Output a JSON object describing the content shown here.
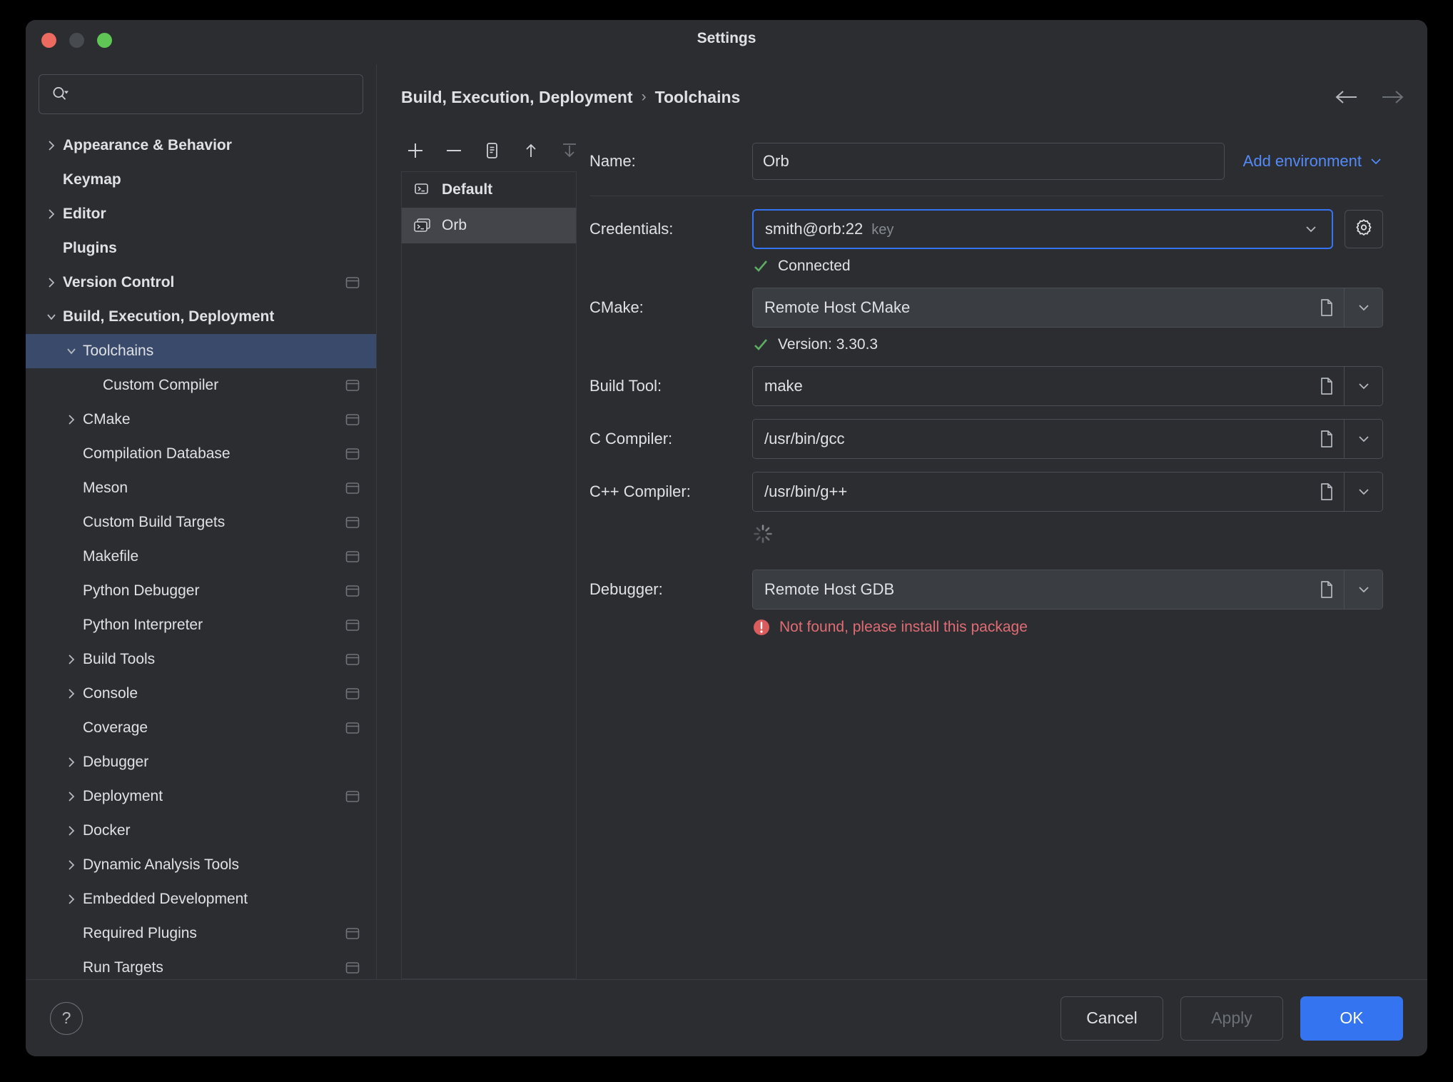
{
  "window": {
    "title": "Settings",
    "traffic_lights": [
      "close-red",
      "minimize-yellow",
      "maximize-green"
    ]
  },
  "search": {
    "value": "",
    "placeholder": ""
  },
  "sidebar": {
    "items": [
      {
        "label": "Appearance & Behavior",
        "level": 0,
        "arrow": "right",
        "bold": true,
        "scope_icon": false
      },
      {
        "label": "Keymap",
        "level": 0,
        "arrow": "none",
        "bold": true,
        "scope_icon": false
      },
      {
        "label": "Editor",
        "level": 0,
        "arrow": "right",
        "bold": true,
        "scope_icon": false
      },
      {
        "label": "Plugins",
        "level": 0,
        "arrow": "none",
        "bold": true,
        "scope_icon": false
      },
      {
        "label": "Version Control",
        "level": 0,
        "arrow": "right",
        "bold": true,
        "scope_icon": true
      },
      {
        "label": "Build, Execution, Deployment",
        "level": 0,
        "arrow": "down",
        "bold": true,
        "scope_icon": false
      },
      {
        "label": "Toolchains",
        "level": 1,
        "arrow": "down",
        "bold": false,
        "scope_icon": false,
        "selected": true
      },
      {
        "label": "Custom Compiler",
        "level": 2,
        "arrow": "none",
        "bold": false,
        "scope_icon": true
      },
      {
        "label": "CMake",
        "level": 1,
        "arrow": "right",
        "bold": false,
        "scope_icon": true
      },
      {
        "label": "Compilation Database",
        "level": 1,
        "arrow": "none",
        "bold": false,
        "scope_icon": true
      },
      {
        "label": "Meson",
        "level": 1,
        "arrow": "none",
        "bold": false,
        "scope_icon": true
      },
      {
        "label": "Custom Build Targets",
        "level": 1,
        "arrow": "none",
        "bold": false,
        "scope_icon": true
      },
      {
        "label": "Makefile",
        "level": 1,
        "arrow": "none",
        "bold": false,
        "scope_icon": true
      },
      {
        "label": "Python Debugger",
        "level": 1,
        "arrow": "none",
        "bold": false,
        "scope_icon": true
      },
      {
        "label": "Python Interpreter",
        "level": 1,
        "arrow": "none",
        "bold": false,
        "scope_icon": true
      },
      {
        "label": "Build Tools",
        "level": 1,
        "arrow": "right",
        "bold": false,
        "scope_icon": true
      },
      {
        "label": "Console",
        "level": 1,
        "arrow": "right",
        "bold": false,
        "scope_icon": true
      },
      {
        "label": "Coverage",
        "level": 1,
        "arrow": "none",
        "bold": false,
        "scope_icon": true
      },
      {
        "label": "Debugger",
        "level": 1,
        "arrow": "right",
        "bold": false,
        "scope_icon": false
      },
      {
        "label": "Deployment",
        "level": 1,
        "arrow": "right",
        "bold": false,
        "scope_icon": true
      },
      {
        "label": "Docker",
        "level": 1,
        "arrow": "right",
        "bold": false,
        "scope_icon": false
      },
      {
        "label": "Dynamic Analysis Tools",
        "level": 1,
        "arrow": "right",
        "bold": false,
        "scope_icon": false
      },
      {
        "label": "Embedded Development",
        "level": 1,
        "arrow": "right",
        "bold": false,
        "scope_icon": false
      },
      {
        "label": "Required Plugins",
        "level": 1,
        "arrow": "none",
        "bold": false,
        "scope_icon": true
      },
      {
        "label": "Run Targets",
        "level": 1,
        "arrow": "none",
        "bold": false,
        "scope_icon": true
      }
    ]
  },
  "breadcrumb": {
    "root": "Build, Execution, Deployment",
    "separator": "›",
    "leaf": "Toolchains"
  },
  "nav": {
    "back": "back-arrow",
    "forward": "forward-arrow"
  },
  "toolchain_toolbar": {
    "add": "add-icon",
    "remove": "remove-icon",
    "copy": "copy-icon",
    "move_up": "move-up-icon",
    "move_down": "move-down-icon"
  },
  "toolchain_list": [
    {
      "label": "Default",
      "icon": "terminal-icon",
      "bold": true,
      "active": false
    },
    {
      "label": "Orb",
      "icon": "remote-terminal-icon",
      "bold": false,
      "active": true
    }
  ],
  "form": {
    "name": {
      "label": "Name:",
      "value": "Orb"
    },
    "add_environment": {
      "label": "Add environment",
      "chevron": "chevron-down-icon"
    },
    "credentials": {
      "label": "Credentials:",
      "value": "smith@orb:22",
      "hint": "key",
      "focused": true,
      "gear": "gear-icon",
      "status": {
        "text": "Connected",
        "type": "ok"
      }
    },
    "cmake": {
      "label": "CMake:",
      "value": "Remote Host CMake",
      "status": {
        "text": "Version: 3.30.3",
        "type": "ok"
      }
    },
    "build_tool": {
      "label": "Build Tool:",
      "value": "make"
    },
    "c_compiler": {
      "label": "C Compiler:",
      "value": "/usr/bin/gcc"
    },
    "cpp_compiler": {
      "label": "C++ Compiler:",
      "value": "/usr/bin/g++"
    },
    "loading_spinner": "loading-spinner-icon",
    "debugger": {
      "label": "Debugger:",
      "value": "Remote Host GDB",
      "status": {
        "text": "Not found, please install this package",
        "type": "error"
      }
    }
  },
  "footer": {
    "help": "?",
    "cancel": "Cancel",
    "apply": "Apply",
    "ok": "OK"
  },
  "colors": {
    "accent": "#3574f0",
    "link": "#548af7",
    "selection": "#3a4a6b",
    "ok": "#5fad65",
    "error": "#e06c75",
    "background": "#2b2d30"
  }
}
